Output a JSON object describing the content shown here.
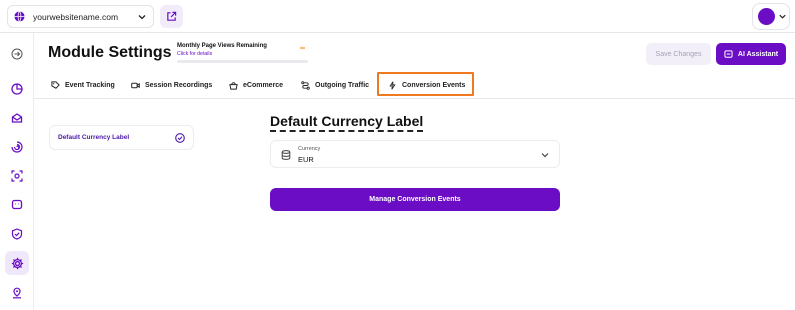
{
  "topbar": {
    "site_name": "yourwebsitename.com",
    "site_icon": "globe-icon",
    "external_link_icon": "external-link-icon",
    "avatar_color": "#6a0dc4"
  },
  "sidebar": {
    "items": [
      {
        "icon": "collapse-icon",
        "active": false
      },
      {
        "icon": "analytics-icon",
        "active": false
      },
      {
        "icon": "inbox-icon",
        "active": false
      },
      {
        "icon": "spiral-icon",
        "active": false
      },
      {
        "icon": "target-icon",
        "active": false
      },
      {
        "icon": "chat-icon",
        "active": false
      },
      {
        "icon": "shield-icon",
        "active": false
      },
      {
        "icon": "gear-icon",
        "active": true
      },
      {
        "icon": "location-icon",
        "active": false
      }
    ]
  },
  "header": {
    "title": "Module Settings",
    "page_views_label": "Monthly Page Views Remaining",
    "page_views_link": "Click for details",
    "page_views_value": "∞",
    "save_label": "Save Changes",
    "ai_label": "AI Assistant"
  },
  "tabs": [
    {
      "label": "Event Tracking",
      "icon": "tag-icon"
    },
    {
      "label": "Session Recordings",
      "icon": "video-icon"
    },
    {
      "label": "eCommerce",
      "icon": "cart-icon"
    },
    {
      "label": "Outgoing Traffic",
      "icon": "route-icon"
    },
    {
      "label": "Conversion Events",
      "icon": "bolt-icon",
      "active": true
    }
  ],
  "side_nav": {
    "item_label": "Default Currency Label"
  },
  "main": {
    "section_title": "Default Currency Label",
    "currency_label": "Currency",
    "currency_value": "EUR",
    "manage_button": "Manage Conversion Events"
  },
  "colors": {
    "accent": "#6a0dc4",
    "highlight": "#f07a1f",
    "infinity": "#f08a24"
  }
}
